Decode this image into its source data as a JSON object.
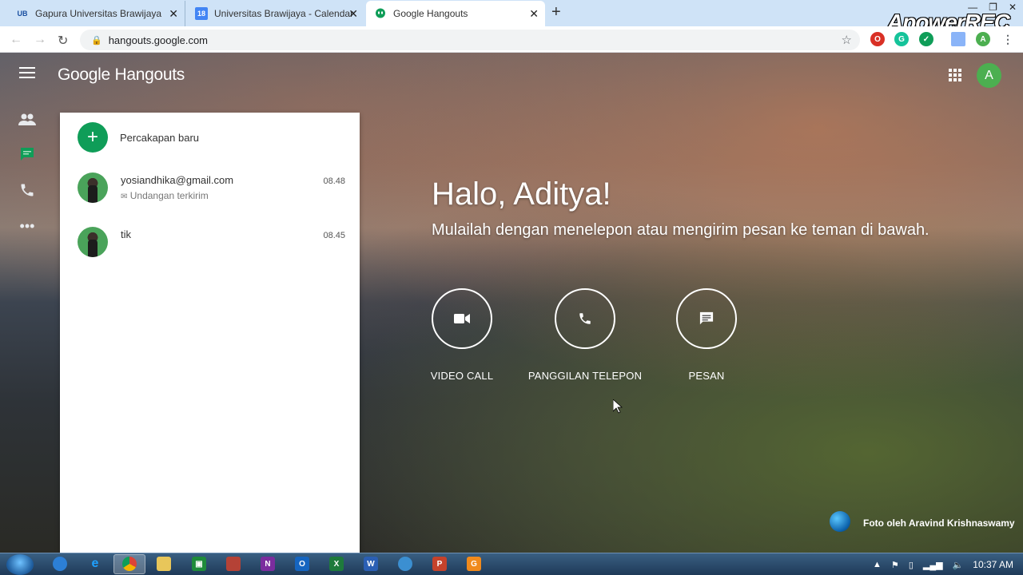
{
  "browser": {
    "tabs": [
      {
        "favicon": "UB",
        "title": "Gapura Universitas Brawijaya"
      },
      {
        "favicon": "18",
        "title": "Universitas Brawijaya - Calendar"
      },
      {
        "favicon": "hangouts-icon",
        "title": "Google Hangouts"
      }
    ],
    "url": "hangouts.google.com",
    "watermark": "ApowerREC"
  },
  "header": {
    "logo_google": "Google",
    "logo_product": "Hangouts",
    "avatar_letter": "A"
  },
  "conversations": {
    "new_label": "Percakapan baru",
    "items": [
      {
        "name": "yosiandhika@gmail.com",
        "sub": "Undangan terkirim",
        "time": "08.48"
      },
      {
        "name": "tik",
        "sub": "",
        "time": "08.45"
      }
    ]
  },
  "welcome": {
    "greeting": "Halo, Aditya!",
    "subtitle": "Mulailah dengan menelepon atau mengirim pesan ke teman di bawah.",
    "actions": [
      {
        "label": "VIDEO CALL",
        "icon": "video-icon"
      },
      {
        "label": "PANGGILAN TELEPON",
        "icon": "phone-icon"
      },
      {
        "label": "PESAN",
        "icon": "message-icon"
      }
    ],
    "credit": "Foto oleh Aravind Krishnaswamy"
  },
  "taskbar": {
    "time": "10:37 AM"
  },
  "colors": {
    "accent_green": "#0f9d58",
    "avatar_green": "#4caf50"
  }
}
